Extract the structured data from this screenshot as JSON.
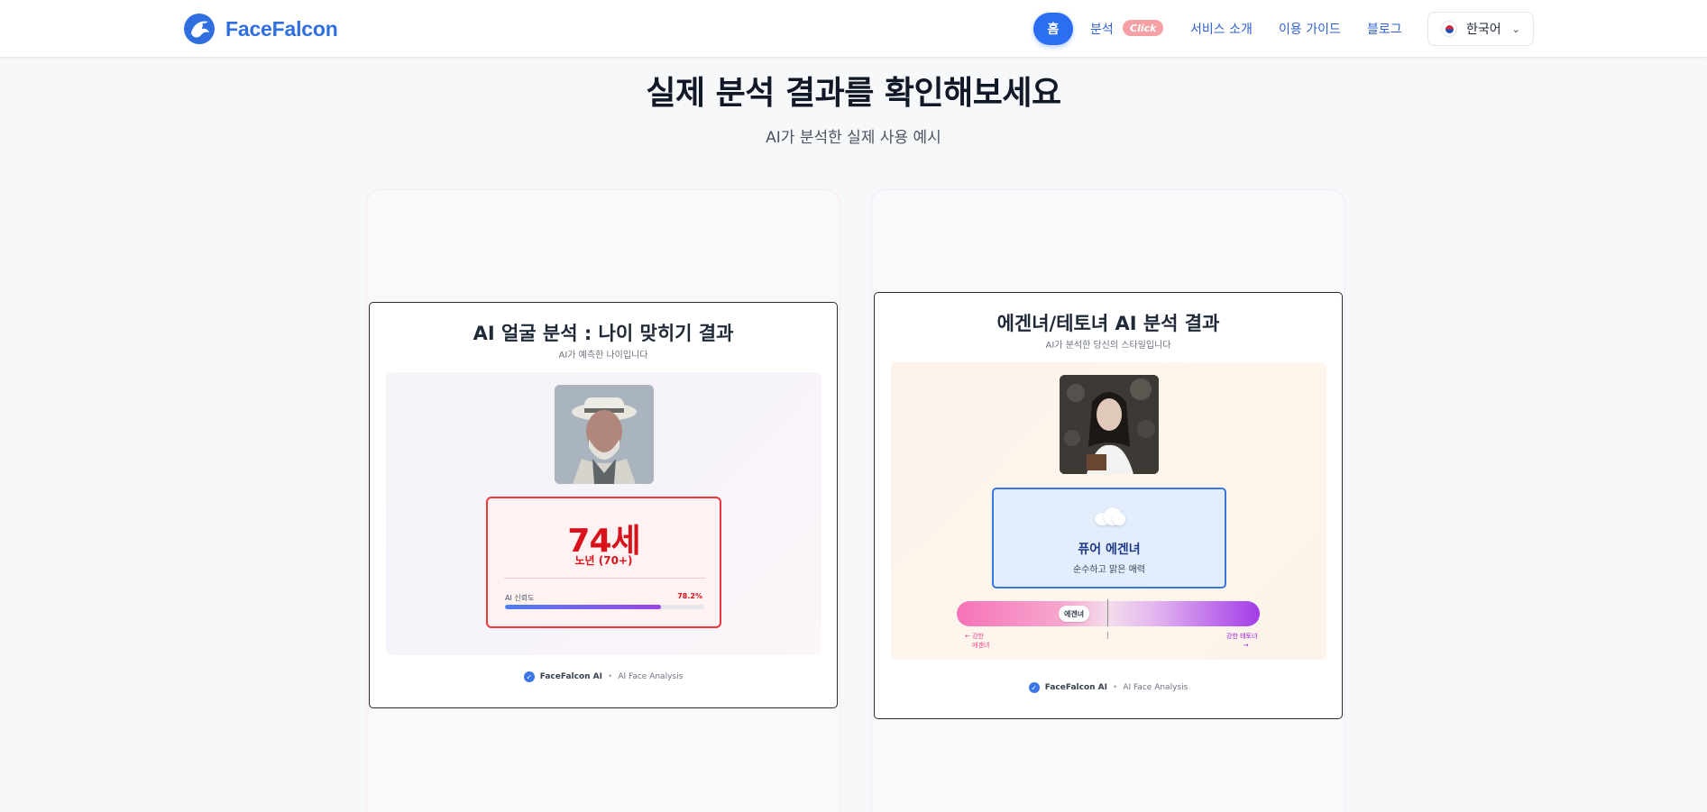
{
  "nav": {
    "brand": "FaceFalcon",
    "home": "홈",
    "analysis": "분석",
    "analysis_badge": "Click",
    "about": "서비스 소개",
    "guide": "이용 가이드",
    "blog": "블로그",
    "language": "한국어"
  },
  "hero": {
    "title": "실제 분석 결과를 확인해보세요",
    "subtitle": "AI가 분석한 실제 사용 예시"
  },
  "age_card": {
    "title": "AI 얼굴 분석 : 나이 맞히기 결과",
    "subtitle": "AI가 예측한 나이입니다",
    "age": "74세",
    "age_group": "노년 (70+)",
    "confidence_label": "AI 신뢰도",
    "confidence_value": "78.2%",
    "confidence_fraction": 0.782,
    "footer_brand": "FaceFalcon AI",
    "footer_text": "AI Face Analysis"
  },
  "style_card": {
    "title": "에겐녀/테토녀 AI 분석 결과",
    "subtitle": "AI가 분석한 당신의 스타일입니다",
    "type_name": "퓨어 에겐녀",
    "type_desc": "순수하고 맑은 매력",
    "marker_label": "에겐녀",
    "left_label_line1": "← 강한",
    "left_label_line2": "에겐녀",
    "right_label_line1": "강한 테토녀",
    "right_label_line2": "→",
    "footer_brand": "FaceFalcon AI",
    "footer_text": "AI Face Analysis"
  },
  "colors": {
    "brand_blue": "#2f6fe0",
    "age_red": "#d9121b",
    "style_blue": "#3b77e0"
  },
  "icons": {
    "brand": "falcon-logo-icon",
    "language_flag": "korea-flag-icon",
    "dropdown": "chevron-down-icon",
    "verified": "check-circle-icon",
    "style_type": "cloud-icon"
  }
}
